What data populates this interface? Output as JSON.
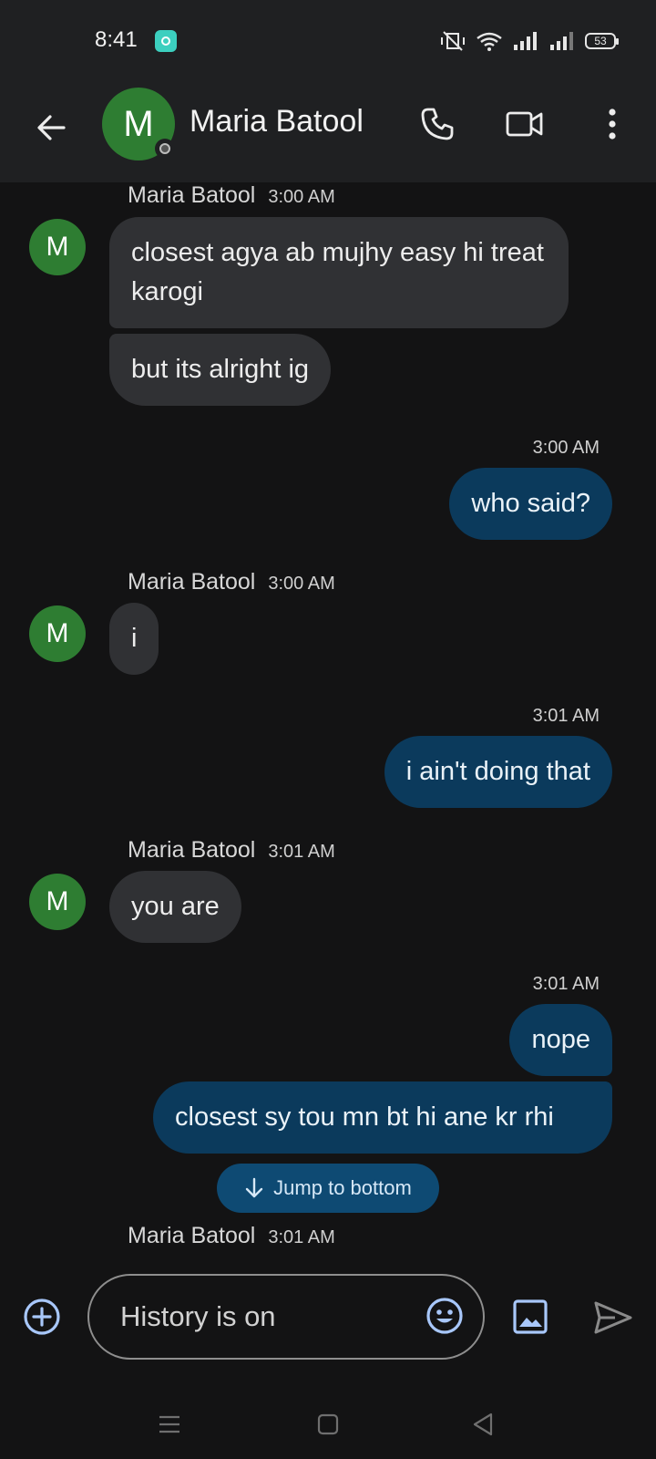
{
  "status_bar": {
    "time": "8:41",
    "app_icon": "camera-app-icon",
    "icons": [
      "vibrate-off-icon",
      "wifi-icon",
      "signal-icon",
      "signal-icon"
    ],
    "battery": "53"
  },
  "header": {
    "avatar_letter": "M",
    "contact_name": "Maria Batool",
    "icons": [
      "back-arrow-icon",
      "phone-icon",
      "video-camera-icon",
      "more-vert-icon"
    ]
  },
  "messages": [
    {
      "direction": "in",
      "sender": "Maria Batool",
      "time": "3:00 AM",
      "avatar": "M",
      "bubbles": [
        "closest agya ab mujhy easy hi treat karogi",
        "but its alright ig"
      ]
    },
    {
      "direction": "out",
      "time": "3:00 AM",
      "bubbles": [
        "who said?"
      ]
    },
    {
      "direction": "in",
      "sender": "Maria Batool",
      "time": "3:00 AM",
      "avatar": "M",
      "bubbles": [
        "i"
      ]
    },
    {
      "direction": "out",
      "time": "3:01 AM",
      "bubbles": [
        "i ain't doing that"
      ]
    },
    {
      "direction": "in",
      "sender": "Maria Batool",
      "time": "3:01 AM",
      "avatar": "M",
      "bubbles": [
        "you are"
      ]
    },
    {
      "direction": "out",
      "time": "3:01 AM",
      "bubbles": [
        "nope",
        "closest sy tou mn bt hi ane kr rhi"
      ]
    },
    {
      "direction": "in",
      "sender": "Maria Batool",
      "time": "3:01 AM",
      "bubbles": []
    }
  ],
  "jump_to_bottom": "Jump to bottom",
  "composer": {
    "placeholder": "History is on",
    "icons": [
      "add-circle-icon",
      "emoji-icon",
      "image-icon",
      "send-icon"
    ]
  },
  "nav_bar": {
    "icons": [
      "menu-icon",
      "home-icon",
      "back-icon"
    ]
  },
  "colors": {
    "incoming_bubble": "#303134",
    "outgoing_bubble": "#0b3a5c",
    "avatar": "#2e7d32",
    "accent": "#a8c7fa"
  }
}
